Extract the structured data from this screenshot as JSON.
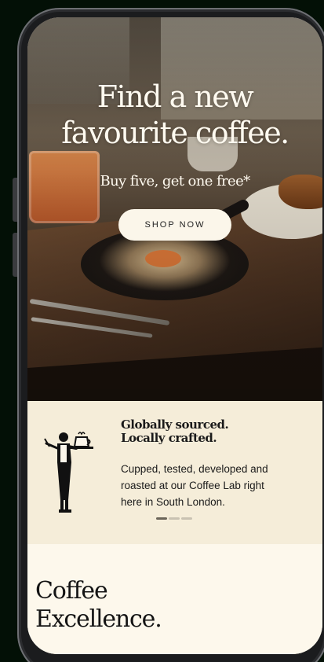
{
  "hero": {
    "title_line1": "Find a new",
    "title_line2": "favourite coffee.",
    "subtitle": "Buy five, get one free*",
    "shop_button_label": "SHOP NOW"
  },
  "promo": {
    "heading_line1": "Globally sourced.",
    "heading_line2": "Locally crafted.",
    "body_line1": "Cupped, tested, developed and",
    "body_line2": "roasted at our Coffee Lab right",
    "body_line3": "here in South London.",
    "carousel": {
      "slides": 3,
      "active_index": 0
    }
  },
  "excellence": {
    "title_line1": "Coffee",
    "title_line2": "Excellence."
  },
  "icons": {
    "illustration": "waiter-serving-coffee-illustration"
  },
  "colors": {
    "page_background": "#031006",
    "cream": "#fbf6ea",
    "promo_background": "#f5edd9",
    "text_dark": "#1a1a1a",
    "dot_active": "#6b6559",
    "dot_inactive": "#c9c2b2"
  }
}
